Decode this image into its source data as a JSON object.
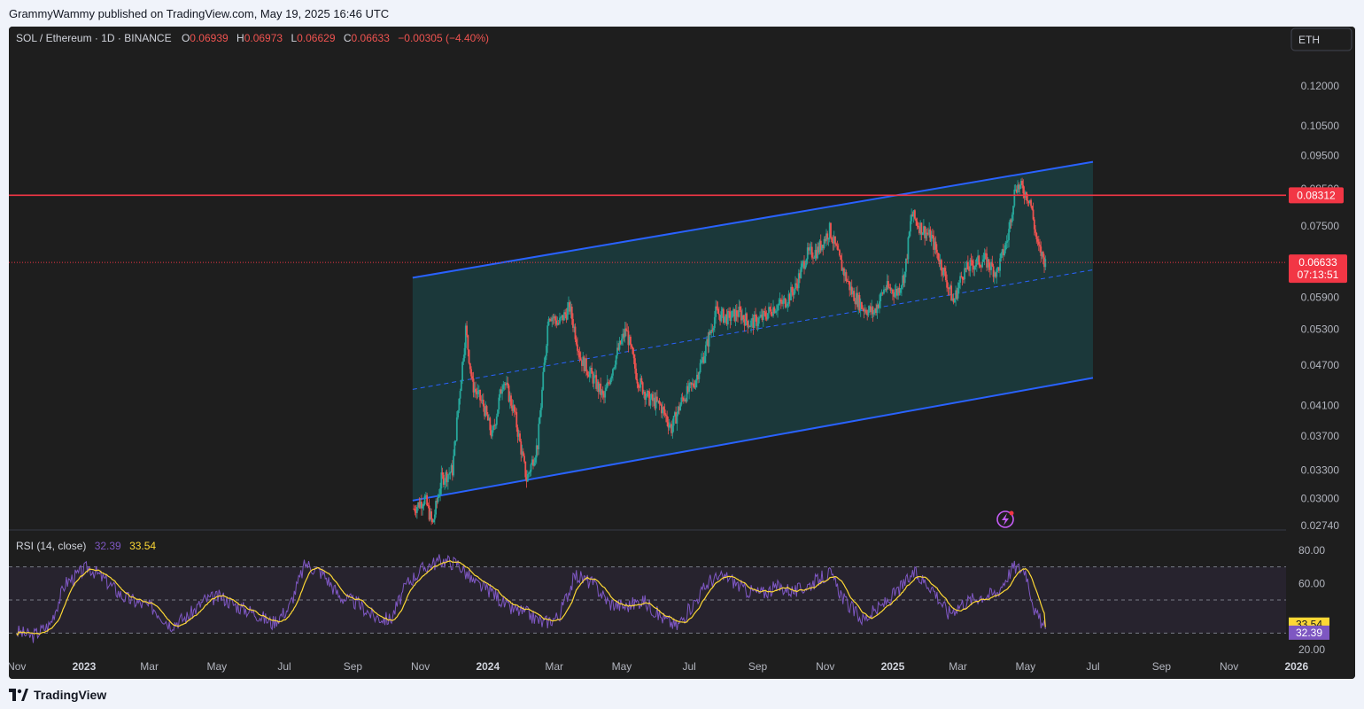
{
  "published": "GrammyWammy published on TradingView.com, May 19, 2025 16:46 UTC",
  "footer": {
    "brand": "TradingView"
  },
  "legend": {
    "symbol": "SOL / Ethereum · 1D · BINANCE",
    "o_label": "O",
    "o_value": "0.06939",
    "h_label": "H",
    "h_value": "0.06973",
    "l_label": "L",
    "l_value": "0.06629",
    "c_label": "C",
    "c_value": "0.06633",
    "change": "−0.00305 (−4.40%)"
  },
  "currency_badge": "ETH",
  "rsi_legend": {
    "label": "RSI (14, close)",
    "rsi_value": "32.39",
    "ma_value": "33.54"
  },
  "colors": {
    "background": "#1e1e1e",
    "up": "#26a69a",
    "down": "#ef5350",
    "channel": "#2962ff",
    "channel_fill": "#1b3d40",
    "resistance": "#f23645",
    "rsi_line": "#7e57c2",
    "rsi_ma": "#fdd835"
  },
  "chart_data": {
    "type": "candlestick",
    "title": "SOL / Ethereum · 1D · BINANCE",
    "price_scale": "log",
    "y_ticks": [
      "0.12000",
      "0.10500",
      "0.09500",
      "0.08500",
      "0.07500",
      "0.05900",
      "0.05300",
      "0.04700",
      "0.04100",
      "0.03700",
      "0.03300",
      "0.03000",
      "0.02740"
    ],
    "x_ticks": [
      "Nov",
      "2023",
      "Mar",
      "May",
      "Jul",
      "Sep",
      "Nov",
      "2024",
      "Mar",
      "May",
      "Jul",
      "Sep",
      "Nov",
      "2025",
      "Mar",
      "May",
      "Jul",
      "Sep",
      "Nov",
      "2026"
    ],
    "x_ticks_bold": [
      "2023",
      "2024",
      "2025",
      "2026"
    ],
    "last_price": {
      "value": "0.06633",
      "countdown": "07:13:51"
    },
    "horizontal_line": {
      "value": "0.08312"
    },
    "price_path": [
      [
        "2023-10-26",
        0.029
      ],
      [
        "2023-11-05",
        0.03
      ],
      [
        "2023-11-12",
        0.0275
      ],
      [
        "2023-11-20",
        0.032
      ],
      [
        "2023-11-30",
        0.033
      ],
      [
        "2023-12-06",
        0.042
      ],
      [
        "2023-12-12",
        0.053
      ],
      [
        "2023-12-18",
        0.044
      ],
      [
        "2023-12-28",
        0.041
      ],
      [
        "2024-01-05",
        0.037
      ],
      [
        "2024-01-15",
        0.045
      ],
      [
        "2024-01-25",
        0.04
      ],
      [
        "2024-02-05",
        0.032
      ],
      [
        "2024-02-15",
        0.036
      ],
      [
        "2024-02-25",
        0.056
      ],
      [
        "2024-03-05",
        0.054
      ],
      [
        "2024-03-15",
        0.057
      ],
      [
        "2024-03-25",
        0.048
      ],
      [
        "2024-04-05",
        0.045
      ],
      [
        "2024-04-15",
        0.042
      ],
      [
        "2024-04-25",
        0.048
      ],
      [
        "2024-05-05",
        0.053
      ],
      [
        "2024-05-15",
        0.045
      ],
      [
        "2024-05-25",
        0.042
      ],
      [
        "2024-06-05",
        0.041
      ],
      [
        "2024-06-15",
        0.038
      ],
      [
        "2024-06-25",
        0.042
      ],
      [
        "2024-07-05",
        0.044
      ],
      [
        "2024-07-15",
        0.049
      ],
      [
        "2024-07-25",
        0.056
      ],
      [
        "2024-08-05",
        0.055
      ],
      [
        "2024-08-15",
        0.056
      ],
      [
        "2024-08-25",
        0.054
      ],
      [
        "2024-09-05",
        0.055
      ],
      [
        "2024-09-15",
        0.057
      ],
      [
        "2024-09-25",
        0.058
      ],
      [
        "2024-10-05",
        0.061
      ],
      [
        "2024-10-15",
        0.068
      ],
      [
        "2024-10-25",
        0.069
      ],
      [
        "2024-11-05",
        0.074
      ],
      [
        "2024-11-15",
        0.066
      ],
      [
        "2024-11-25",
        0.06
      ],
      [
        "2024-12-05",
        0.057
      ],
      [
        "2024-12-15",
        0.056
      ],
      [
        "2024-12-25",
        0.061
      ],
      [
        "2025-01-05",
        0.06
      ],
      [
        "2025-01-12",
        0.064
      ],
      [
        "2025-01-18",
        0.078
      ],
      [
        "2025-01-25",
        0.075
      ],
      [
        "2025-02-05",
        0.072
      ],
      [
        "2025-02-15",
        0.065
      ],
      [
        "2025-02-25",
        0.058
      ],
      [
        "2025-03-05",
        0.064
      ],
      [
        "2025-03-15",
        0.066
      ],
      [
        "2025-03-25",
        0.067
      ],
      [
        "2025-04-05",
        0.064
      ],
      [
        "2025-04-15",
        0.072
      ],
      [
        "2025-04-22",
        0.086
      ],
      [
        "2025-04-28",
        0.085
      ],
      [
        "2025-05-05",
        0.082
      ],
      [
        "2025-05-12",
        0.07
      ],
      [
        "2025-05-19",
        0.0663
      ]
    ],
    "channel": {
      "upper": [
        [
          "2023-10-25",
          0.063
        ],
        [
          "2025-07-01",
          0.093
        ]
      ],
      "lower": [
        [
          "2023-10-25",
          0.0298
        ],
        [
          "2025-07-01",
          0.045
        ]
      ],
      "middle": [
        [
          "2023-10-25",
          0.0433
        ],
        [
          "2025-07-01",
          0.0647
        ]
      ]
    },
    "rsi": {
      "label": "RSI (14, close)",
      "levels": [
        70,
        50,
        30
      ],
      "y_ticks": [
        "80.00",
        "60.00",
        "20.00"
      ],
      "current": 32.39,
      "ma_current": 33.54,
      "path": [
        [
          "2022-11-01",
          31
        ],
        [
          "2022-11-15",
          28
        ],
        [
          "2022-12-01",
          35
        ],
        [
          "2022-12-15",
          60
        ],
        [
          "2023-01-05",
          70
        ],
        [
          "2023-01-20",
          62
        ],
        [
          "2023-02-05",
          52
        ],
        [
          "2023-02-20",
          48
        ],
        [
          "2023-03-05",
          45
        ],
        [
          "2023-03-20",
          35
        ],
        [
          "2023-04-05",
          40
        ],
        [
          "2023-04-20",
          50
        ],
        [
          "2023-05-05",
          52
        ],
        [
          "2023-05-20",
          46
        ],
        [
          "2023-06-05",
          42
        ],
        [
          "2023-06-20",
          36
        ],
        [
          "2023-07-05",
          45
        ],
        [
          "2023-07-20",
          72
        ],
        [
          "2023-08-05",
          66
        ],
        [
          "2023-08-20",
          52
        ],
        [
          "2023-09-05",
          48
        ],
        [
          "2023-09-20",
          40
        ],
        [
          "2023-10-05",
          38
        ],
        [
          "2023-10-20",
          60
        ],
        [
          "2023-11-05",
          70
        ],
        [
          "2023-11-20",
          74
        ],
        [
          "2023-12-05",
          72
        ],
        [
          "2023-12-20",
          60
        ],
        [
          "2024-01-05",
          55
        ],
        [
          "2024-01-20",
          45
        ],
        [
          "2024-02-05",
          42
        ],
        [
          "2024-02-20",
          36
        ],
        [
          "2024-03-05",
          40
        ],
        [
          "2024-03-20",
          65
        ],
        [
          "2024-04-05",
          60
        ],
        [
          "2024-04-20",
          48
        ],
        [
          "2024-05-05",
          46
        ],
        [
          "2024-05-20",
          50
        ],
        [
          "2024-06-05",
          40
        ],
        [
          "2024-06-20",
          34
        ],
        [
          "2024-07-05",
          48
        ],
        [
          "2024-07-20",
          62
        ],
        [
          "2024-08-05",
          64
        ],
        [
          "2024-08-20",
          56
        ],
        [
          "2024-09-05",
          54
        ],
        [
          "2024-09-20",
          58
        ],
        [
          "2024-10-05",
          55
        ],
        [
          "2024-10-20",
          60
        ],
        [
          "2024-11-05",
          66
        ],
        [
          "2024-11-20",
          48
        ],
        [
          "2024-12-05",
          38
        ],
        [
          "2024-12-20",
          45
        ],
        [
          "2025-01-05",
          55
        ],
        [
          "2025-01-20",
          66
        ],
        [
          "2025-02-05",
          58
        ],
        [
          "2025-02-20",
          42
        ],
        [
          "2025-03-05",
          48
        ],
        [
          "2025-03-20",
          52
        ],
        [
          "2025-04-05",
          54
        ],
        [
          "2025-04-20",
          70
        ],
        [
          "2025-05-01",
          68
        ],
        [
          "2025-05-10",
          42
        ],
        [
          "2025-05-19",
          32.39
        ]
      ]
    }
  }
}
